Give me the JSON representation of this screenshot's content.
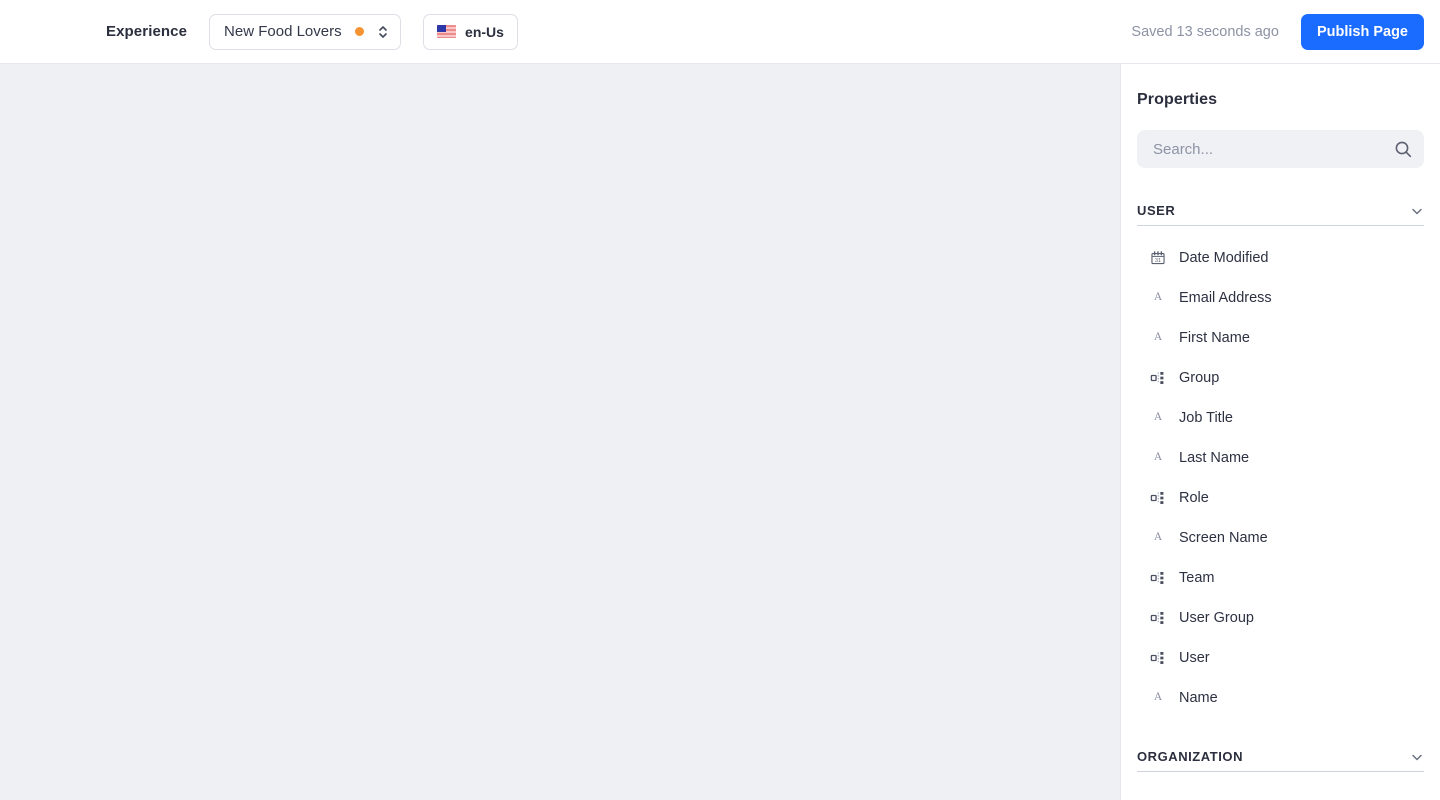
{
  "topbar": {
    "experience_label": "Experience",
    "experience_value": "New Food Lovers",
    "status_dot_color": "#f59231",
    "locale": "en-Us",
    "saved_status": "Saved 13 seconds ago",
    "publish_label": "Publish Page",
    "publish_color": "#1a6bff"
  },
  "panel": {
    "title": "Properties",
    "search_placeholder": "Search...",
    "search_value": "",
    "sections": [
      {
        "name": "USER",
        "expanded": true,
        "items": [
          {
            "label": "Date Modified",
            "icon": "calendar-icon"
          },
          {
            "label": "Email Address",
            "icon": "text-icon"
          },
          {
            "label": "First Name",
            "icon": "text-icon"
          },
          {
            "label": "Group",
            "icon": "relation-icon"
          },
          {
            "label": "Job Title",
            "icon": "text-icon"
          },
          {
            "label": "Last Name",
            "icon": "text-icon"
          },
          {
            "label": "Role",
            "icon": "relation-icon"
          },
          {
            "label": "Screen Name",
            "icon": "text-icon"
          },
          {
            "label": "Team",
            "icon": "relation-icon"
          },
          {
            "label": "User Group",
            "icon": "relation-icon"
          },
          {
            "label": "User",
            "icon": "relation-icon"
          },
          {
            "label": "Name",
            "icon": "text-icon"
          }
        ]
      },
      {
        "name": "ORGANIZATION",
        "expanded": false,
        "items": []
      }
    ]
  }
}
